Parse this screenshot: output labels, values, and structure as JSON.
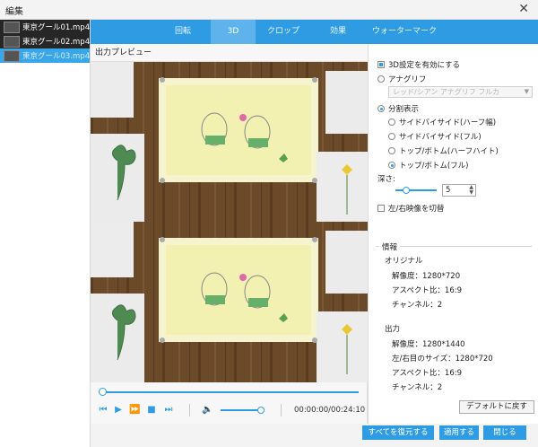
{
  "window": {
    "title": "編集",
    "close_glyph": "✕"
  },
  "files": [
    {
      "name": "東京グール01.mp4"
    },
    {
      "name": "東京グール02.mp4"
    },
    {
      "name": "東京グール03.mp4"
    }
  ],
  "tabs": [
    {
      "label": "回転"
    },
    {
      "label": "3D"
    },
    {
      "label": "クロップ"
    },
    {
      "label": "効果"
    },
    {
      "label": "ウォーターマーク"
    }
  ],
  "preview": {
    "header": "出力プレビュー"
  },
  "player": {
    "timecode": "00:00:00/00:24:10",
    "progress": 0.0,
    "volume": 0.9
  },
  "settings3d": {
    "enable_label": "3D設定を有効にする",
    "enable_checked": true,
    "anaglyph_label": "アナグリフ",
    "anaglyph_select": "レッド/シアン アナグリフ フルカ",
    "split_label": "分割表示",
    "split_options": [
      {
        "label": "サイドバイサイド(ハーフ幅)"
      },
      {
        "label": "サイドバイサイド(フル)"
      },
      {
        "label": "トップ/ボトム(ハーフハイト)"
      },
      {
        "label": "トップ/ボトム(フル)"
      }
    ],
    "selected_split_index": 3,
    "depth_label": "深さ:",
    "depth_value": "5",
    "swap_label": "左/右映像を切替"
  },
  "info": {
    "title": "情報",
    "original_label": "オリジナル",
    "original_resolution": "解像度：1280*720",
    "original_aspect": "アスペクト比：16:9",
    "original_channels": "チャンネル：2",
    "output_label": "出力",
    "output_resolution": "解像度：1280*1440",
    "output_eye_size": "左/右目のサイズ：1280*720",
    "output_aspect": "アスペクト比：16:9",
    "output_channels": "チャンネル：2"
  },
  "buttons": {
    "reset_default": "デフォルトに戻す",
    "restore_all": "すべてを復元する",
    "apply": "適用する",
    "close": "閉じる"
  },
  "colors": {
    "accent": "#2e9be3",
    "tab_active": "#5fb3ec",
    "selected_file": "#38a6e8"
  }
}
